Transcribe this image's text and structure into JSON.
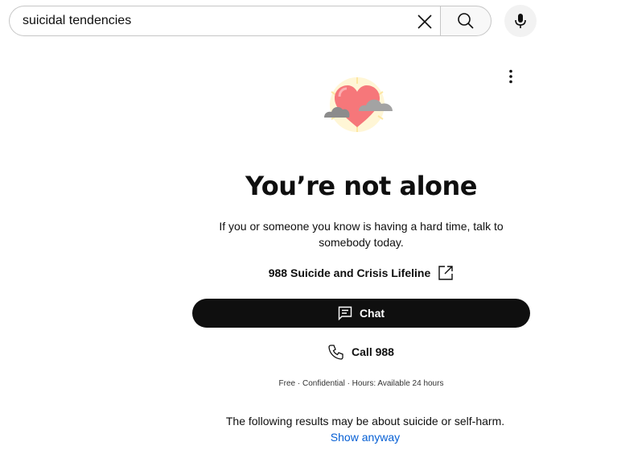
{
  "search": {
    "query": "suicidal tendencies",
    "clear_icon": "close-icon",
    "search_icon": "search-icon",
    "mic_icon": "mic-icon"
  },
  "panel": {
    "more_icon": "more-vert-icon",
    "illustration": "heart-with-clouds",
    "headline": "You’re not alone",
    "subtext": "If you or someone you know is having a hard time, talk to somebody today.",
    "lifeline_label": "988 Suicide and Crisis Lifeline",
    "lifeline_icon": "external-link-icon",
    "chat_label": "Chat",
    "chat_icon": "chat-icon",
    "call_label": "Call 988",
    "call_icon": "phone-icon",
    "fine_print": "Free · Confidential · Hours: Available 24 hours"
  },
  "results_warning": {
    "text": "The following results may be about suicide or self-harm.",
    "show_label": "Show anyway"
  },
  "colors": {
    "primary_text": "#0f0f0f",
    "link": "#065fd4",
    "chat_button_bg": "#0f0f0f",
    "heart": "#f6777a",
    "cloud": "#8c8c8c"
  }
}
